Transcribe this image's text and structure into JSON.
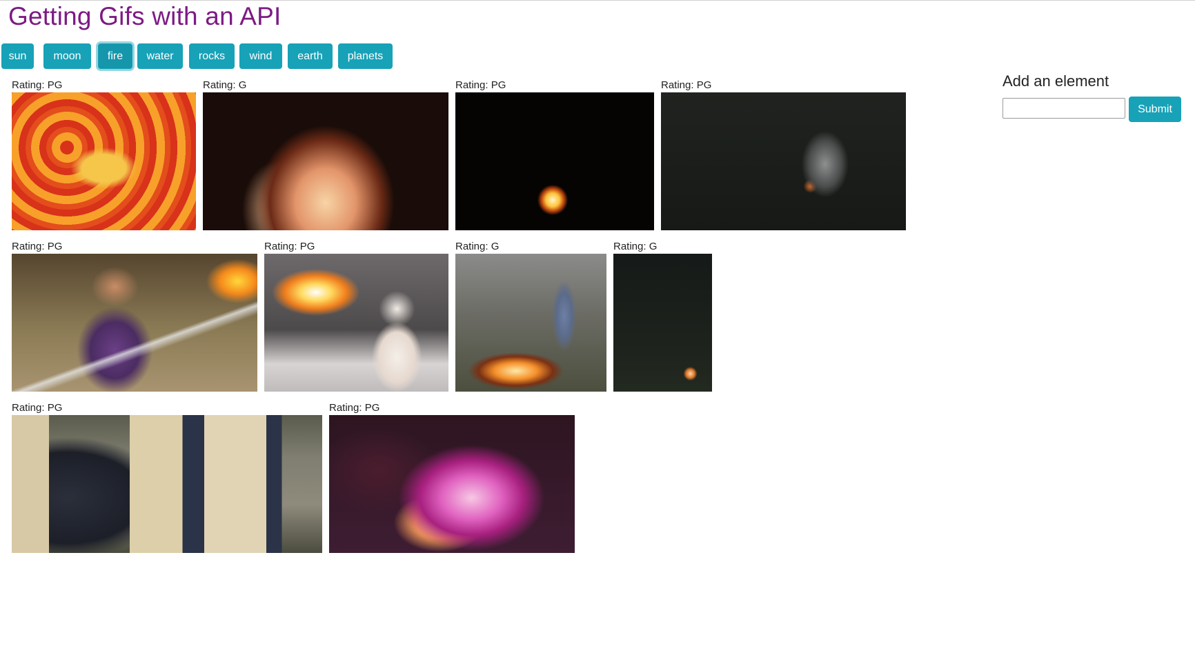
{
  "page": {
    "title": "Getting Gifs with an API"
  },
  "topics": [
    "sun",
    "moon",
    "fire",
    "water",
    "rocks",
    "wind",
    "earth",
    "planets"
  ],
  "active_topic": "fire",
  "gifs": [
    {
      "rating": "Rating: PG"
    },
    {
      "rating": "Rating: G"
    },
    {
      "rating": "Rating: PG"
    },
    {
      "rating": "Rating: PG"
    },
    {
      "rating": "Rating: PG"
    },
    {
      "rating": "Rating: PG"
    },
    {
      "rating": "Rating: G"
    },
    {
      "rating": "Rating: G"
    },
    {
      "rating": "Rating: PG"
    },
    {
      "rating": "Rating: PG"
    }
  ],
  "add_form": {
    "title": "Add an element",
    "input_value": "",
    "submit_label": "Submit"
  },
  "colors": {
    "title": "#7d1a84",
    "button": "#17a2b8"
  }
}
